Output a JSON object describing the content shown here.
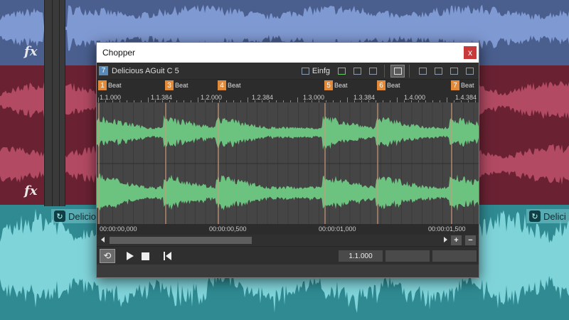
{
  "window": {
    "title": "Chopper",
    "close_label": "x"
  },
  "toolbar": {
    "clip_index": "7",
    "clip_name": "Delicious AGuit C 5",
    "insert_label": "Einfg"
  },
  "markers": [
    {
      "num": "1",
      "label": "Beat"
    },
    {
      "num": "3",
      "label": "Beat"
    },
    {
      "num": "4",
      "label": "Beat"
    },
    {
      "num": "5",
      "label": "Beat"
    },
    {
      "num": "6",
      "label": "Beat"
    },
    {
      "num": "7",
      "label": "Beat"
    }
  ],
  "ruler": [
    "1.1.000",
    "1.1.384",
    "1.2.000",
    "1.2.384",
    "1.3.000",
    "1.3.384",
    "1.4.000",
    "1.4.384"
  ],
  "timeline": [
    "00:00:00,000",
    "00:00:00,500",
    "00:00:01,000",
    "00:00:01,500"
  ],
  "scroll": {
    "zoom_in": "+",
    "zoom_out": "−"
  },
  "transport": {
    "position": "1.1.000",
    "loop_icon": "⟲"
  },
  "background": {
    "fx_label": "fx",
    "clip_label_left": "Delicio",
    "clip_label_right": "Delici",
    "colors": {
      "blue_track": "#4a5f8e",
      "red_track": "#6a2233",
      "cyan_track": "#2f8a92",
      "wave_green": "#6cc27f",
      "marker_orange": "#e08a3a"
    }
  }
}
